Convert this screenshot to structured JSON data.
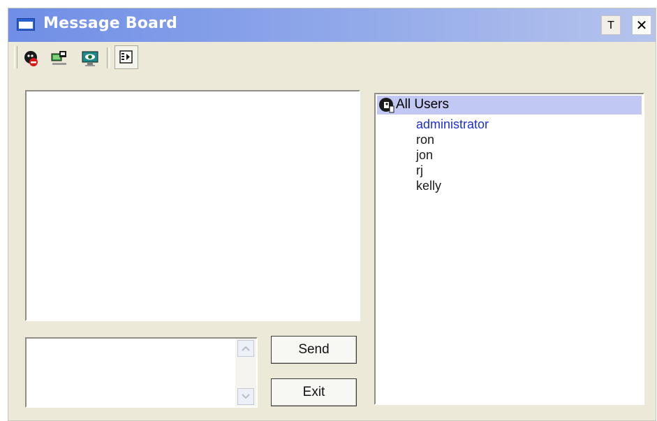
{
  "window": {
    "title": "Message Board",
    "pin_label": "T",
    "close_label": "✕"
  },
  "toolbar": {
    "icons": [
      "do-not-disturb-icon",
      "broadcast-icon",
      "monitor-view-icon",
      "exit-panel-icon"
    ]
  },
  "message_area": {
    "text": ""
  },
  "input": {
    "text": ""
  },
  "buttons": {
    "send": "Send",
    "exit": "Exit"
  },
  "users_tree": {
    "root_label": "All Users",
    "users": [
      "administrator",
      "ron",
      "jon",
      "rj",
      "kelly"
    ],
    "selected_user": "administrator"
  },
  "colors": {
    "title_gradient_start": "#6f8ee6",
    "title_gradient_end": "#b6c4ec",
    "window_bg": "#ece9d8",
    "selected_user": "#1c2fd4",
    "tree_root_highlight": "#c2c8f4"
  }
}
